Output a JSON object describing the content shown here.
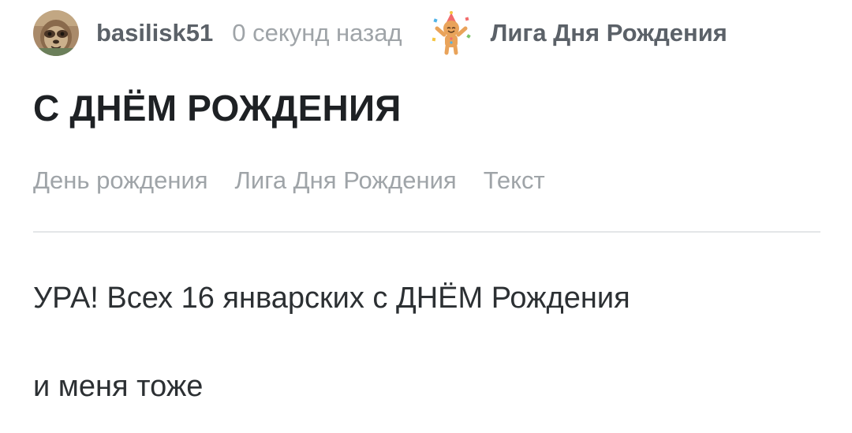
{
  "post": {
    "author": "basilisk51",
    "time": "0 секунд назад",
    "community": "Лига Дня Рождения",
    "title": "С ДНЁМ РОЖДЕНИЯ",
    "tags": [
      "День рождения",
      "Лига Дня Рождения",
      "Текст"
    ],
    "content": [
      "УРА! Всех 16 январских с ДНЁМ Рождения",
      "и меня тоже"
    ],
    "avatar_icon": "sloth-avatar-icon",
    "community_icon": "birthday-cookie-icon"
  },
  "colors": {
    "meta_text": "#5b6168",
    "muted_text": "#9fa4a8",
    "title_text": "#1e2124",
    "body_text": "#2c3033",
    "divider": "#e4e6e8"
  }
}
